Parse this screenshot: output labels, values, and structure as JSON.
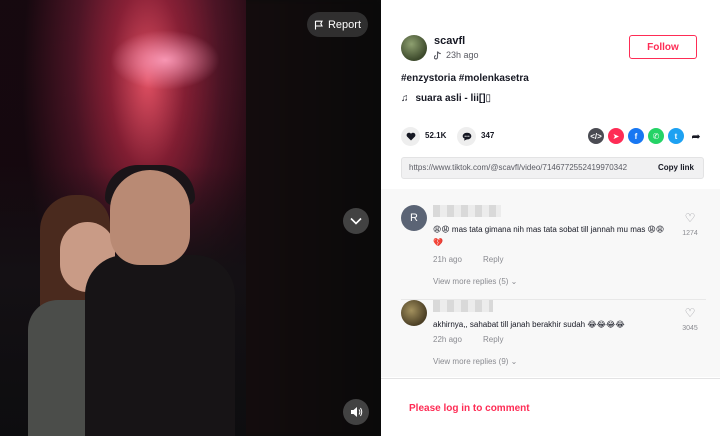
{
  "video": {
    "report_label": "Report",
    "report_icon": "flag-icon",
    "scroll_icon": "chevron-down-icon",
    "mute_icon": "speaker-icon"
  },
  "author": {
    "username": "scavfl",
    "time_ago": "23h ago",
    "follow_label": "Follow"
  },
  "caption": "#enzystoria #molenkasetra",
  "music": {
    "icon": "music-note-icon",
    "label": "suara asli - lii[]▯"
  },
  "stats": {
    "likes": "52.1K",
    "comments": "347"
  },
  "share": {
    "icons": [
      "embed-icon",
      "send-icon",
      "facebook-icon",
      "whatsapp-icon",
      "twitter-icon",
      "share-arrow-icon"
    ],
    "colors": {
      "embed": "#4b4c53",
      "send": "#fe2c55",
      "facebook": "#1877f2",
      "whatsapp": "#25d366",
      "twitter": "#1da1f2"
    }
  },
  "link": {
    "url": "https://www.tiktok.com/@scavfl/video/7146772552419970342",
    "copy_label": "Copy link"
  },
  "comments": [
    {
      "avatar_letter": "R",
      "text": "😩😩 mas tata gimana nih mas tata sobat till jannah mu mas 😩😩💔",
      "time": "21h ago",
      "reply_label": "Reply",
      "view_more": "View more replies (5)",
      "likes": "1274"
    },
    {
      "avatar_letter": "",
      "text": "akhirnya,, sahabat till janah berakhir sudah 😂😂😂😂",
      "time": "22h ago",
      "reply_label": "Reply",
      "view_more": "View more replies (9)",
      "likes": "3045"
    }
  ],
  "login_prompt": "Please log in to comment"
}
